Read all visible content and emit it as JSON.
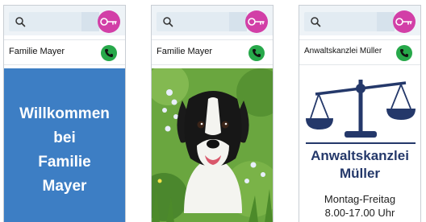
{
  "screens": [
    {
      "contact_name": "Familie Mayer",
      "welcome_lines": [
        "Willkommen",
        "bei",
        "Familie",
        "Mayer"
      ]
    },
    {
      "contact_name": "Familie Mayer",
      "image_subject": "dog photo"
    },
    {
      "contact_name": "Anwaltskanzlei Müller",
      "title_lines": [
        "Anwaltskanzlei",
        "Müller"
      ],
      "hours_lines": [
        "Montag-Freitag",
        "8.00-17.00 Uhr"
      ]
    }
  ],
  "colors": {
    "key_button": "#d23fa7",
    "call_button": "#27a84a",
    "welcome_background": "#3d7ec4",
    "law_navy": "#24386a"
  },
  "icons": {
    "search": "search-icon",
    "key": "key-icon",
    "call": "phone-icon",
    "scales": "scales-icon"
  }
}
